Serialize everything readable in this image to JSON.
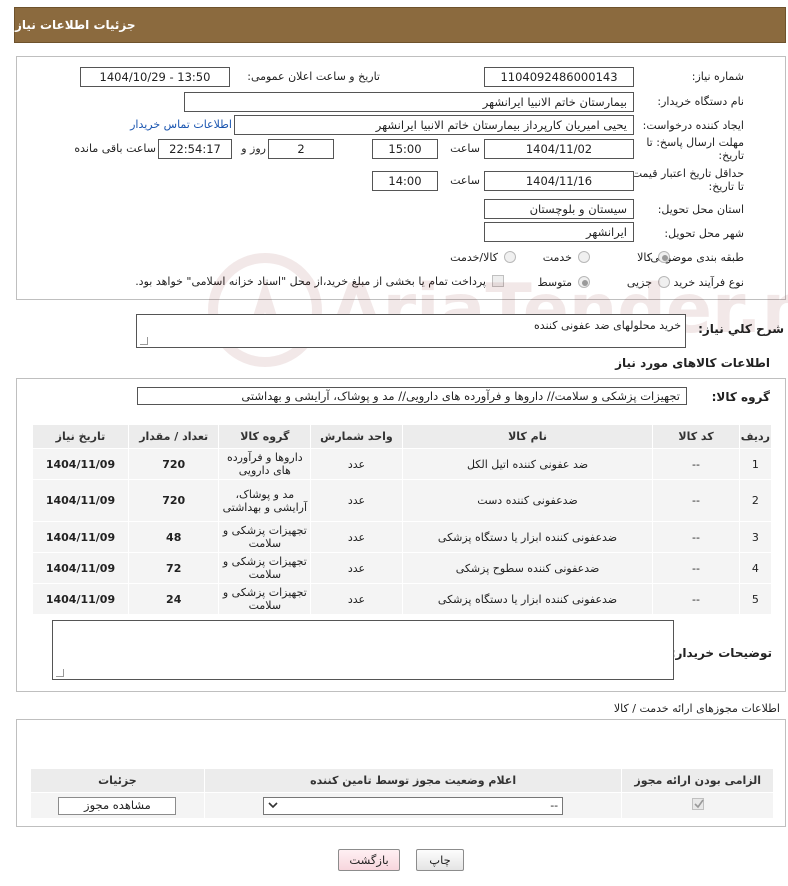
{
  "header": {
    "title": "جزئیات اطلاعات نیاز"
  },
  "form": {
    "need_number_label": "شماره نیاز:",
    "need_number": "1104092486000143",
    "announce_label": "تاریخ و ساعت اعلان عمومی:",
    "announce_value": "1404/10/29 - 13:50",
    "buyer_org_label": "نام دستگاه خریدار:",
    "buyer_org": "بیمارستان خاتم الانبیا ایرانشهر",
    "creator_label": "ایجاد کننده درخواست:",
    "creator": "یحیی امیریان کارپرداز بیمارستان خاتم الانبیا ایرانشهر",
    "contact_link": "اطلاعات تماس خریدار",
    "send_deadline_label_1": "مهلت ارسال پاسخ: تا",
    "send_deadline_label_2": "تاریخ:",
    "send_date": "1404/11/02",
    "time_label": "ساعت",
    "send_time": "15:00",
    "days_value": "2",
    "days_label": "روز و",
    "remaining_time": "22:54:17",
    "remaining_label": "ساعت باقی مانده",
    "price_deadline_label_1": "حداقل تاریخ اعتبار قیمت:",
    "price_deadline_label_2": "تا تاریخ:",
    "price_date": "1404/11/16",
    "price_time_label": "ساعت",
    "price_time": "14:00",
    "province_label": "استان محل تحویل:",
    "province": "سیستان و بلوچستان",
    "city_label": "شهر محل تحویل:",
    "city": "ایرانشهر",
    "category_label": "طبقه بندی موضوعی:",
    "category_options": [
      "کالا",
      "خدمت",
      "کالا/خدمت"
    ],
    "process_label": "نوع فرآیند خرید :",
    "process_options": [
      "جزیی",
      "متوسط"
    ],
    "payment_note": "پرداخت تمام یا بخشی از مبلغ خرید،از محل \"اسناد خزانه اسلامی\" خواهد بود."
  },
  "summary": {
    "label": "شرح کلي نياز:",
    "text": "خرید محلولهای ضد عفونی کننده"
  },
  "goods": {
    "section_title": "اطلاعات کالاهای مورد نیاز",
    "group_label": "گروه کالا:",
    "group_value": "تجهیزات پزشکی و سلامت// داروها و فرآورده های دارویی// مد و پوشاک، آرایشی و بهداشتی",
    "columns": [
      "ردیف",
      "کد کالا",
      "نام کالا",
      "واحد شمارش",
      "گروه کالا",
      "تعداد / مقدار",
      "تاریخ نیاز"
    ],
    "rows": [
      {
        "idx": "1",
        "code": "--",
        "name": "ضد عفونی کننده اتیل الکل",
        "unit": "عدد",
        "group": "داروها و فرآورده های دارویی",
        "qty": "720",
        "date": "1404/11/09"
      },
      {
        "idx": "2",
        "code": "--",
        "name": "ضدعفونی کننده دست",
        "unit": "عدد",
        "group": "مد و پوشاک، آرایشی و بهداشتی",
        "qty": "720",
        "date": "1404/11/09"
      },
      {
        "idx": "3",
        "code": "--",
        "name": "ضدعفونی کننده ابزار یا دستگاه پزشکی",
        "unit": "عدد",
        "group": "تجهیزات پزشکی و سلامت",
        "qty": "48",
        "date": "1404/11/09"
      },
      {
        "idx": "4",
        "code": "--",
        "name": "ضدعفونی کننده سطوح پزشکی",
        "unit": "عدد",
        "group": "تجهیزات پزشکی و سلامت",
        "qty": "72",
        "date": "1404/11/09"
      },
      {
        "idx": "5",
        "code": "--",
        "name": "ضدعفونی کننده ابزار یا دستگاه پزشکی",
        "unit": "عدد",
        "group": "تجهیزات پزشکی و سلامت",
        "qty": "24",
        "date": "1404/11/09"
      }
    ],
    "buyer_notes_label": "توضیحات خریدار:"
  },
  "permits": {
    "section_title": "اطلاعات مجوزهای ارائه خدمت / کالا",
    "columns": [
      "الزامی بودن ارائه مجوز",
      "اعلام وضعیت مجوز توسط تامین کننده",
      "جزئیات"
    ],
    "select_value": "--",
    "view_button": "مشاهده مجوز"
  },
  "actions": {
    "print": "چاپ",
    "back": "بازگشت"
  },
  "watermark": {
    "text": "AriaTender.neT"
  }
}
